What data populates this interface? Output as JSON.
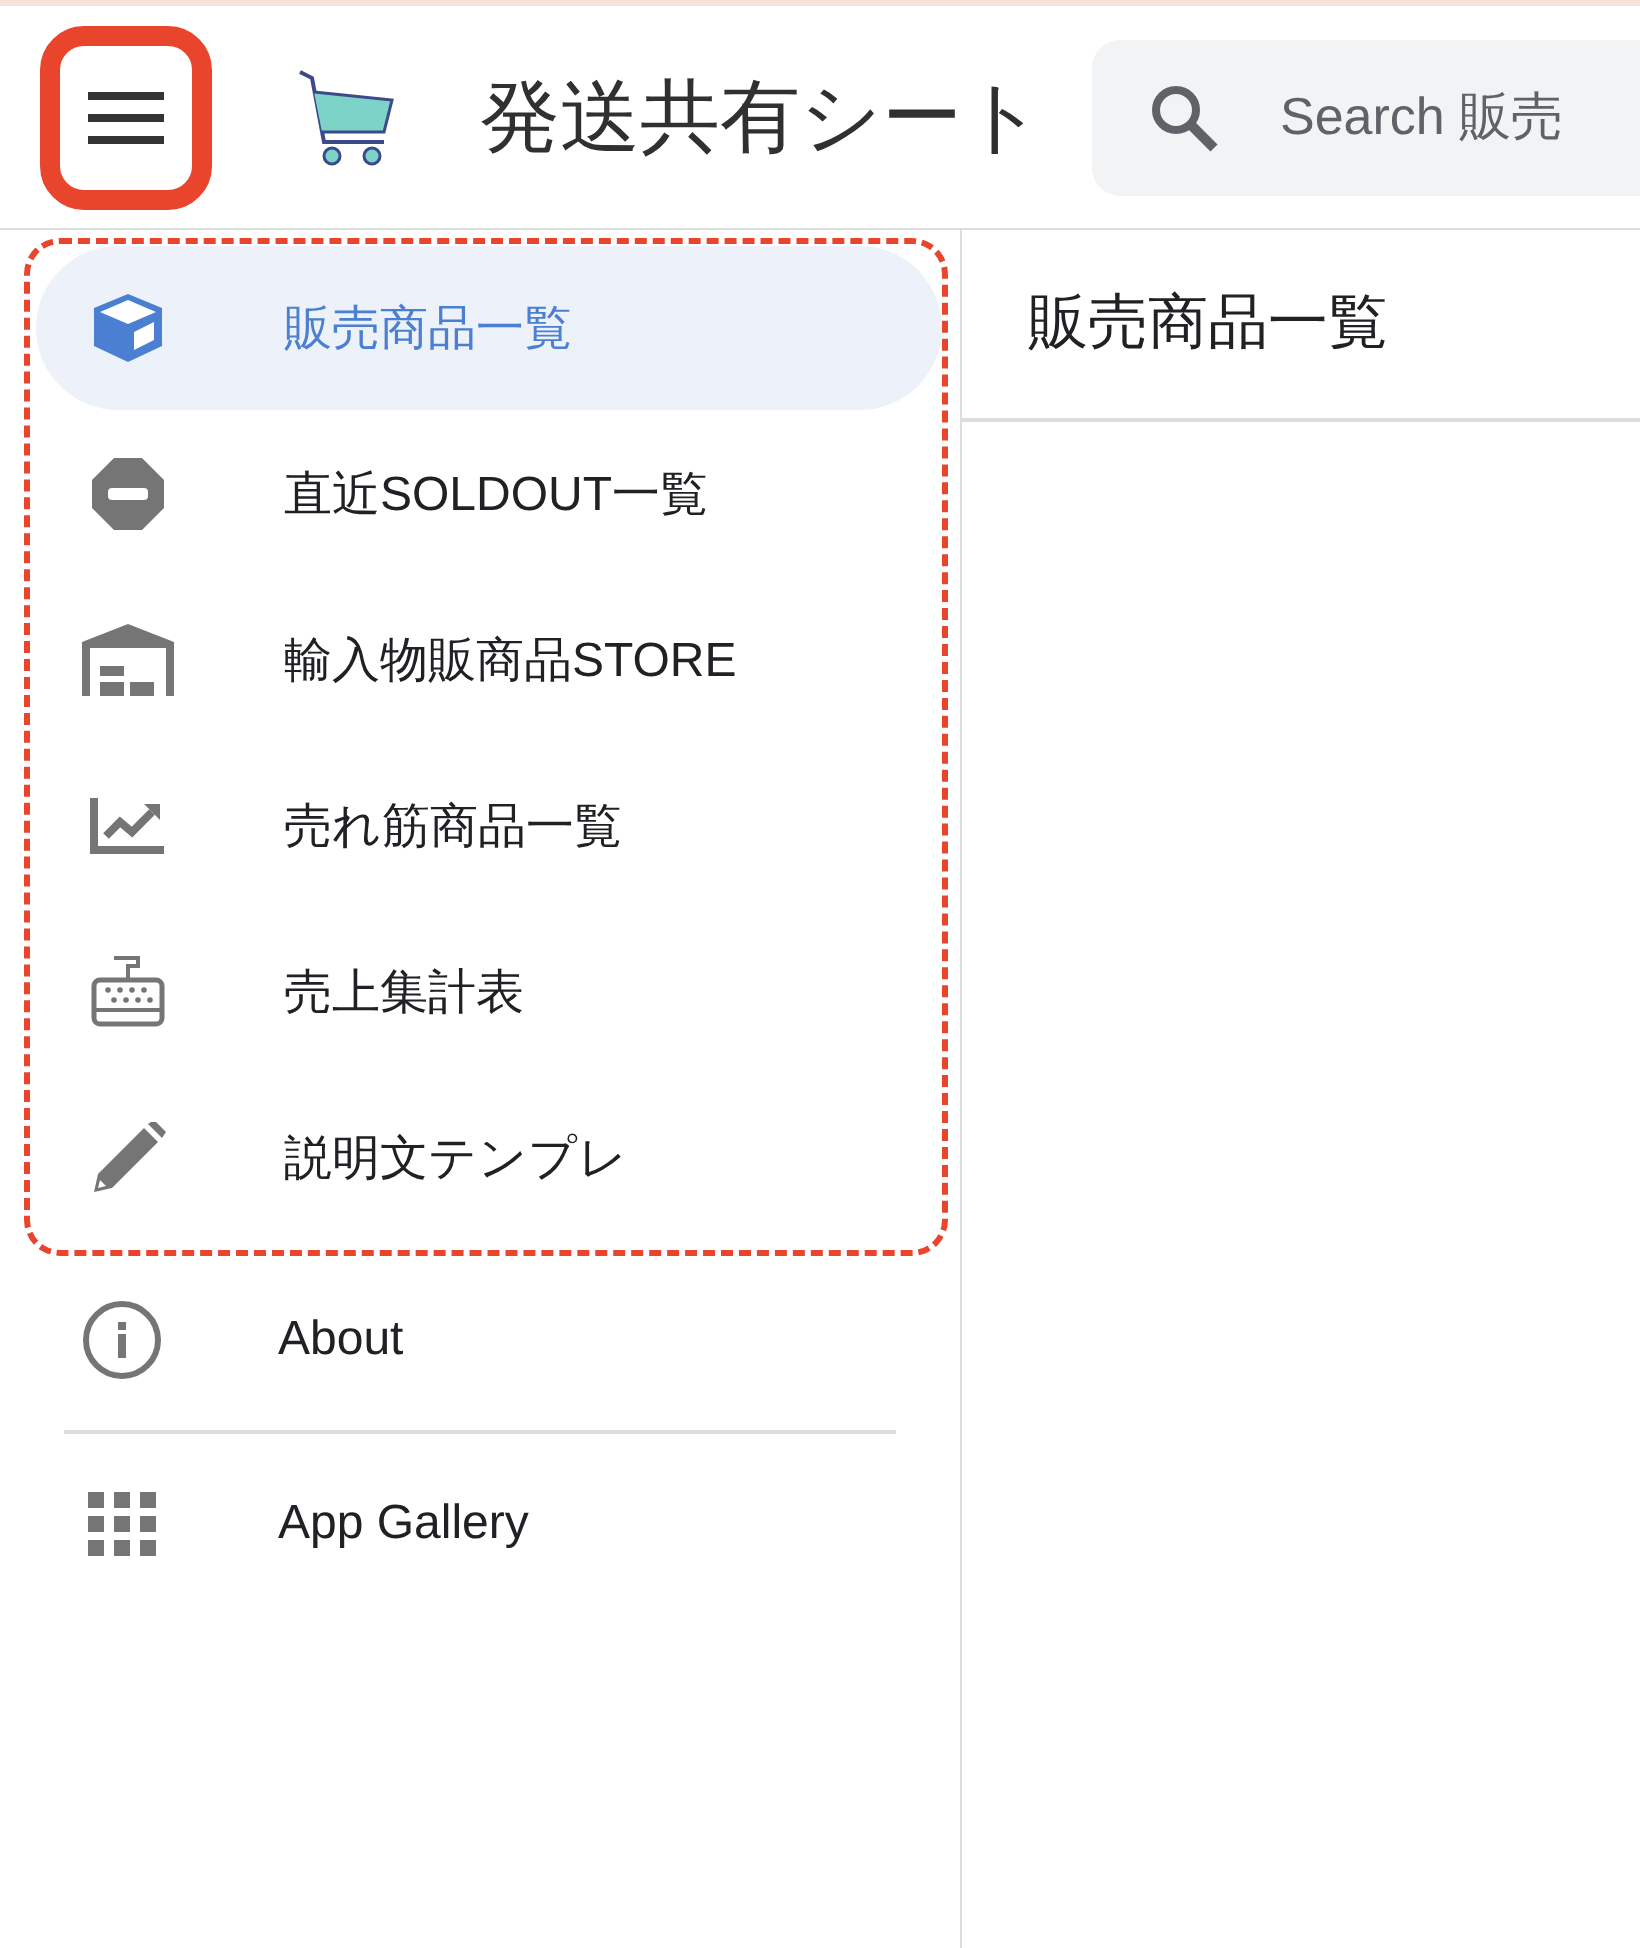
{
  "app_bar": {
    "title": "発送共有シート",
    "menu_button_highlighted": true,
    "search": {
      "placeholder": "Search 販売"
    }
  },
  "sidebar": {
    "group_highlighted": true,
    "items": [
      {
        "label": "販売商品一覧",
        "kind": "box",
        "selected": true
      },
      {
        "label": "直近SOLDOUT一覧",
        "kind": "stop",
        "selected": false
      },
      {
        "label": "輸入物販商品STORE",
        "kind": "warehouse",
        "selected": false
      },
      {
        "label": "売れ筋商品一覧",
        "kind": "trend",
        "selected": false
      },
      {
        "label": "売上集計表",
        "kind": "register",
        "selected": false
      },
      {
        "label": "説明文テンプレ",
        "kind": "pencil",
        "selected": false
      }
    ],
    "footer_items": [
      {
        "label": "About",
        "kind": "info"
      },
      {
        "label": "App Gallery",
        "kind": "apps"
      }
    ]
  },
  "main": {
    "heading": "販売商品一覧"
  }
}
